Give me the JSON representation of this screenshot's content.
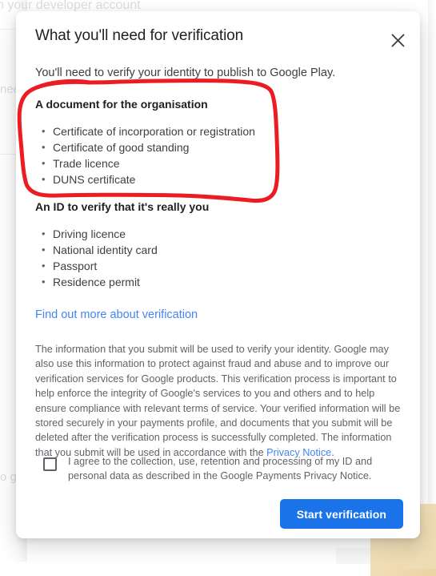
{
  "background": {
    "text_top": "n your developer account",
    "text_mid": "nee",
    "text_bottom": "o g"
  },
  "dialog": {
    "title": "What you'll need for verification",
    "subtitle": "You'll need to verify your identity to publish to Google Play.",
    "close_icon": "close-icon",
    "sections": [
      {
        "heading": "A document for the organisation",
        "items": [
          "Certificate of incorporation or registration",
          "Certificate of good standing",
          "Trade licence",
          "DUNS certificate"
        ]
      },
      {
        "heading": "An ID to verify that it's really you",
        "items": [
          "Driving licence",
          "National identity card",
          "Passport",
          "Residence permit"
        ]
      }
    ],
    "find_out_more_link": "Find out more about verification",
    "fineprint": {
      "body": "The information that you submit will be used to verify your identity. Google may also use this information to protect against fraud and abuse and to improve our verification services for Google products. This verification process is important to help enforce the integrity of Google's services to you and others and to help ensure compliance with relevant terms of service. Your verified information will be stored securely in your payments profile, and documents that you submit will be deleted after the verification process is successfully completed. The information that you submit will be used in accordance with the ",
      "link": "Privacy Notice",
      "tail": "."
    },
    "consent": {
      "checked": false,
      "label": "I agree to the collection, use, retention and processing of my ID and personal data as described in the Google Payments Privacy Notice."
    },
    "primary_button": "Start verification"
  },
  "annotation": {
    "type": "freehand-circle",
    "color": "#ec1c24",
    "stroke_width": 5,
    "description": "hand-drawn red loop around the organisation document list"
  },
  "colors": {
    "accent_blue": "#1a73e8",
    "link_blue": "#4285f4",
    "text_primary": "#202124",
    "text_secondary": "#3c4043",
    "text_muted": "#5f6368",
    "annotation_red": "#ec1c24",
    "blob_cream": "#f0dcb2"
  }
}
